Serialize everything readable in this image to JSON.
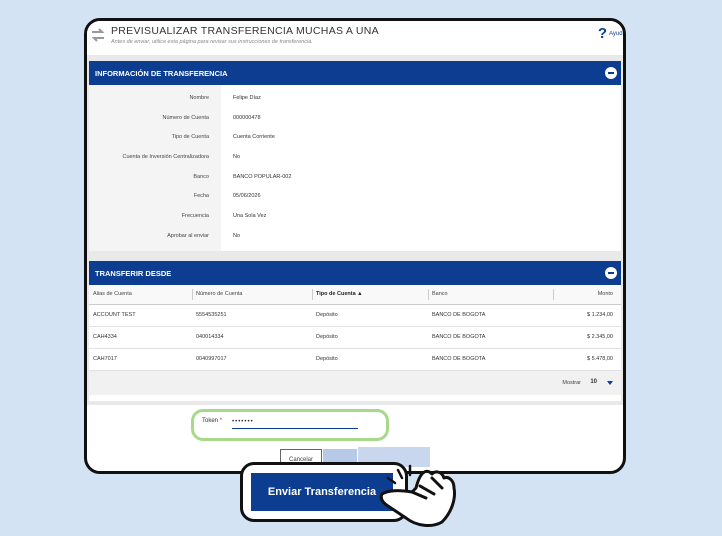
{
  "header": {
    "title": "PREVISUALIZAR TRANSFERENCIA MUCHAS A UNA",
    "subtitle": "Antes de enviar, utilice esta página para revisar sus instrucciones de transferencia.",
    "help_label": "Ayuda"
  },
  "info_panel": {
    "title": "INFORMACIÓN DE TRANSFERENCIA",
    "rows": [
      {
        "label": "Nombre",
        "value": "Felipe Díaz"
      },
      {
        "label": "Número de Cuenta",
        "value": "000000478"
      },
      {
        "label": "Tipo de Cuenta",
        "value": "Cuenta Corriente"
      },
      {
        "label": "Cuenta de Inversión Centralizadora",
        "value": "No"
      },
      {
        "label": "Banco",
        "value": "BANCO POPULAR-002"
      },
      {
        "label": "Fecha",
        "value": "05/06/2026"
      },
      {
        "label": "Frecuencia",
        "value": "Una Sola Vez"
      },
      {
        "label": "Aprobar al enviar",
        "value": "No"
      }
    ]
  },
  "from_panel": {
    "title": "TRANSFERIR DESDE",
    "columns": [
      "Alias de Cuenta",
      "Número de Cuenta",
      "Tipo de Cuenta",
      "Banco",
      "Monto"
    ],
    "sort_indicator": "▲",
    "rows": [
      [
        "ACCOUNT TEST",
        "5554535251",
        "Depósito",
        "BANCO DE BOGOTA",
        "$ 1.234,00"
      ],
      [
        "CAH4334",
        "040014334",
        "Depósito",
        "BANCO DE BOGOTA",
        "$ 2.345,00"
      ],
      [
        "CAH7017",
        "0040997017",
        "Depósito",
        "BANCO DE BOGOTA",
        "$ 5.478,00"
      ]
    ],
    "pager": {
      "label": "Mostrar",
      "value": "10"
    }
  },
  "token": {
    "label": "Token",
    "required_mark": "*",
    "value": "•••••••"
  },
  "actions": {
    "cancel_label": "Cancelar",
    "send_label": "Enviar Transferencia"
  },
  "colors": {
    "primary": "#0d3d91",
    "background": "#d3e3f4",
    "highlight_green": "#a8d98a"
  }
}
